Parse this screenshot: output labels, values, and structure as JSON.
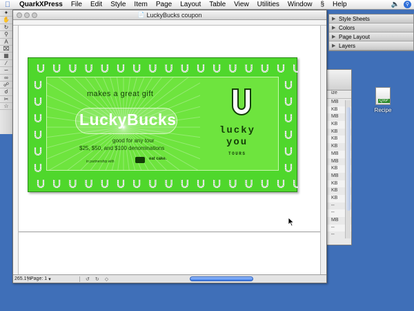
{
  "menubar": {
    "app": "QuarkXPress",
    "items": [
      "File",
      "Edit",
      "Style",
      "Item",
      "Page",
      "Layout",
      "Table",
      "View",
      "Utilities",
      "Window",
      "Help"
    ],
    "right_icons": [
      "script-icon",
      "speaker-icon",
      "search-icon"
    ]
  },
  "palettes": [
    "Style Sheets",
    "Colors",
    "Page Layout",
    "Layers"
  ],
  "document": {
    "title": "LuckyBucks coupon",
    "zoom": "265.1%",
    "page_label": "Page:",
    "page_value": "1"
  },
  "coupon": {
    "tagline": "makes a great gift",
    "brand": "LuckyBucks",
    "good_for": "good for any tour",
    "denominations": "$25, $50, and $100 denominations",
    "partnership": "in partnership with",
    "partner_name": "eat cake.",
    "logo_word1": "lucky",
    "logo_word2": "you",
    "logo_word3": "TOURS",
    "colors": {
      "outer": "#4fd72c",
      "inner": "#6ee43e",
      "ink": "#143d08"
    }
  },
  "background_window": {
    "column_header": "ize",
    "rows": [
      "MB",
      "KB",
      "MB",
      "KB",
      "KB",
      "KB",
      "KB",
      "MB",
      "MB",
      "KB",
      "MB",
      "KB",
      "KB",
      "KB",
      "--",
      "--",
      "MB",
      "--",
      "--"
    ]
  },
  "desktop": {
    "icon_label": "Recipe"
  },
  "tools": [
    "pointer-tool",
    "content-tool",
    "rotate-tool",
    "zoom-tool",
    "text-box-tool",
    "picture-box-tool",
    "table-tool",
    "line-tool",
    "bezier-line-tool",
    "text-path-tool",
    "linking-tool",
    "unlinking-tool",
    "scissors-tool",
    "star-tool"
  ]
}
